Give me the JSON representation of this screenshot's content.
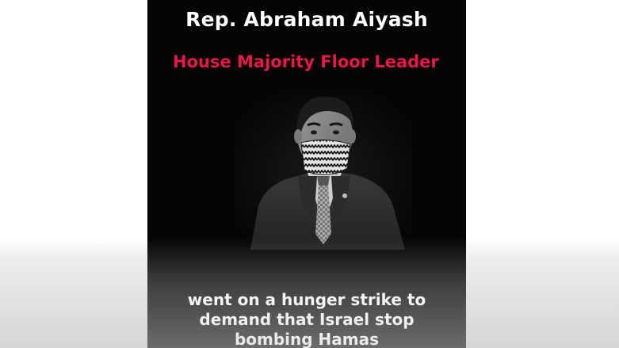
{
  "card": {
    "title": "Rep. Abraham Aiyash",
    "subtitle": "House Majority Floor Leader",
    "caption_lines": [
      "went on a hunger strike to",
      "demand that Israel stop",
      "bombing Hamas"
    ]
  },
  "colors": {
    "background": "#ffffff",
    "card_background": "#050505",
    "title_text": "#ffffff",
    "subtitle_text": "#e8194a",
    "caption_text": "#ffffff"
  }
}
